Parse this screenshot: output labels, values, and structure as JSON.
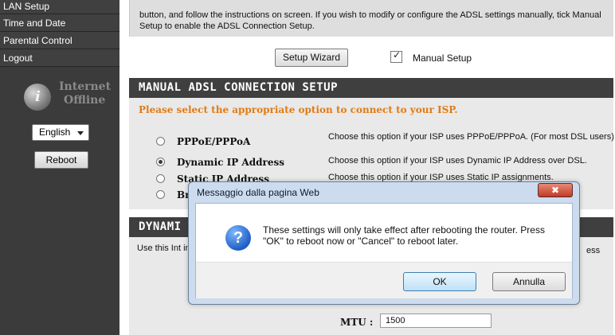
{
  "sidebar": {
    "items": [
      {
        "label": "LAN Setup"
      },
      {
        "label": "Time and Date"
      },
      {
        "label": "Parental Control"
      },
      {
        "label": "Logout"
      }
    ],
    "status_line1": "Internet",
    "status_line2": "Offline",
    "language": "English",
    "reboot_label": "Reboot"
  },
  "intro": {
    "text": "button, and follow the instructions on screen. If you wish to modify or configure the ADSL settings manually, tick Manual Setup to enable the ADSL Connection Setup."
  },
  "controls": {
    "wizard_label": "Setup Wizard",
    "manual_label": "Manual Setup",
    "manual_checked": true
  },
  "manual": {
    "header": "MANUAL ADSL CONNECTION SETUP",
    "prompt": "Please select the appropriate option to connect to your ISP.",
    "options": [
      {
        "label": "PPPoE/PPPoA",
        "desc": "Choose this option if your ISP uses PPPoE/PPPoA. (For most DSL users)",
        "selected": false
      },
      {
        "label": "Dynamic IP Address",
        "desc": "Choose this option if your ISP uses Dynamic IP Address over DSL.",
        "selected": true
      },
      {
        "label": "Static IP Address",
        "desc": "Choose this option if your ISP uses Static IP assignments.",
        "selected": false
      },
      {
        "label": "Brid",
        "desc": "",
        "selected": false
      }
    ]
  },
  "dynamic": {
    "header": "DYNAMI",
    "desc": "Use this Int information",
    "desc_right": "ess",
    "mtu_label": "MTU :",
    "mtu_value": "1500"
  },
  "dialog": {
    "title": "Messaggio dalla pagina Web",
    "close_icon": "close-icon",
    "message": "These settings will only take effect after rebooting the router. Press \"OK\" to reboot now or \"Cancel\" to reboot later.",
    "ok_label": "OK",
    "cancel_label": "Annulla"
  }
}
